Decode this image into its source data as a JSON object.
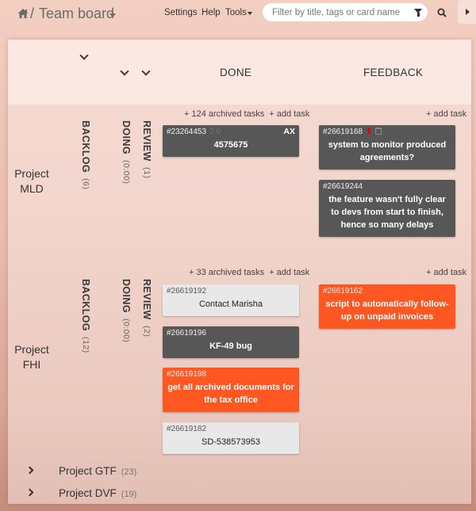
{
  "header": {
    "home_icon": "home-icon",
    "separator": "/",
    "title": "Team board",
    "nav": {
      "settings": "Settings",
      "help": "Help",
      "tools": "Tools"
    },
    "search": {
      "placeholder": "Filter by title, tags or card name",
      "value": ""
    },
    "filter_icon": "filter-icon",
    "search_icon": "search-icon",
    "sidebar_toggle_icon": "caret-right-icon"
  },
  "columns": {
    "backlog": "BACKLOG",
    "doing": "DOING",
    "review": "REVIEW",
    "done": "DONE",
    "feedback": "FEEDBACK"
  },
  "colors": {
    "card_dark": "#575757",
    "card_orange": "#ff5722",
    "card_light": "#e8e8e8",
    "priority_red": "#ee0000"
  },
  "projects": [
    {
      "name_line1": "Project",
      "name_line2": "MLD",
      "backlog_count": "(6)",
      "doing_count": "(0:00)",
      "review_count": "(1)",
      "done_archived": "+ 124 archived tasks",
      "done_add": "+ add task",
      "feedback_add": "+ add task",
      "done_cards": [
        {
          "id": "#23264453",
          "extra": "2.0",
          "assignee": "AX",
          "title": "4575675",
          "style": "dark"
        }
      ],
      "feedback_cards": [
        {
          "id": "#26619168",
          "priority_icon": "arrow-up-icon",
          "calendar_icon": "calendar-icon",
          "title": "system to monitor produced agreements?",
          "style": "dark"
        },
        {
          "id": "#26619244",
          "title": "the feature wasn't fully clear to devs from start to finish, hence so many delays",
          "style": "dark"
        }
      ]
    },
    {
      "name_line1": "Project",
      "name_line2": "FHI",
      "backlog_count": "(12)",
      "doing_count": "(0:00)",
      "review_count": "(2)",
      "done_archived": "+ 33 archived tasks",
      "done_add": "+ add task",
      "feedback_add": "+ add task",
      "done_cards": [
        {
          "id": "#26619192",
          "title": "Contact Marisha",
          "style": "light"
        },
        {
          "id": "#26619196",
          "title": "KF-49 bug",
          "style": "dark"
        },
        {
          "id": "#26619198",
          "title": "get all archived documents for the tax office",
          "style": "orange"
        },
        {
          "id": "#26619182",
          "title": "SD-538573953",
          "style": "light"
        }
      ],
      "feedback_cards": [
        {
          "id": "#26619162",
          "title": "script to automatically follow-up on unpaid invoices",
          "style": "orange"
        }
      ]
    }
  ],
  "collapsed_projects": [
    {
      "name": "Project GTF",
      "count": "(23)"
    },
    {
      "name": "Project DVF",
      "count": "(19)"
    }
  ]
}
